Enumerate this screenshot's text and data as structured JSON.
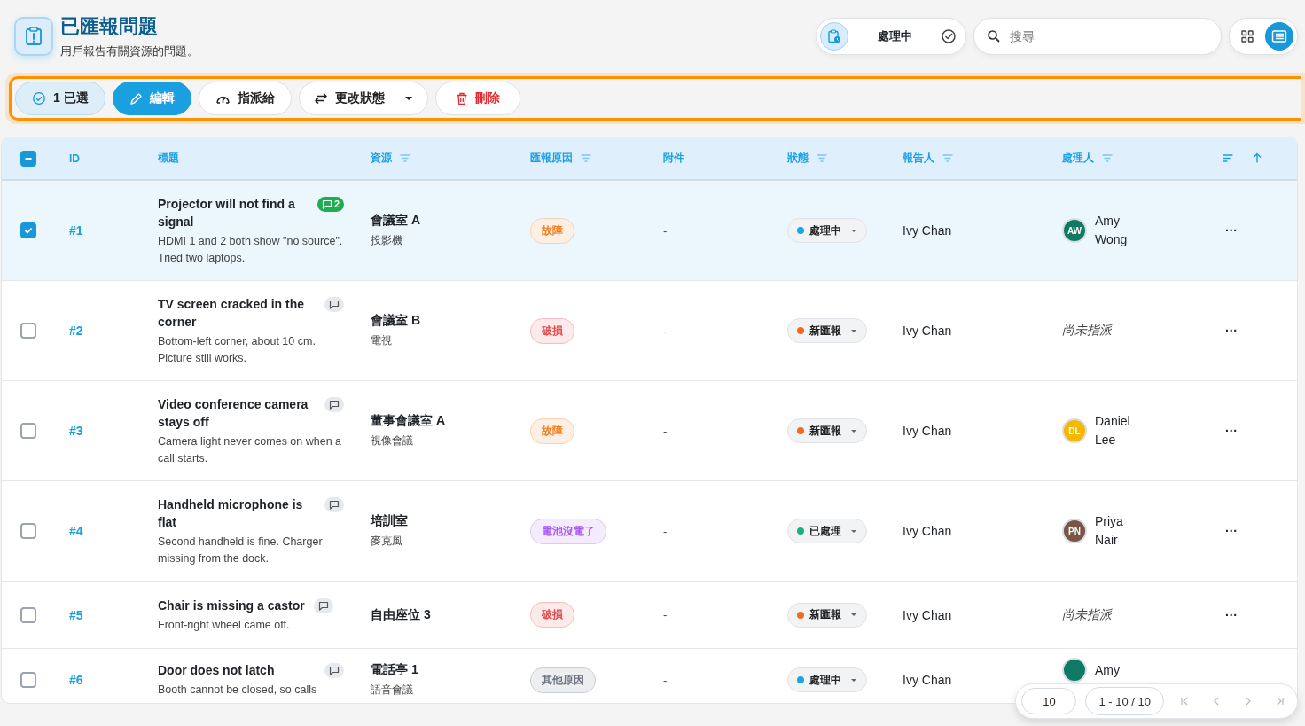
{
  "header": {
    "title": "已匯報問題",
    "subtitle": "用戶報告有關資源的問題。"
  },
  "status_filter": {
    "label": "處理中"
  },
  "search": {
    "placeholder": "搜尋"
  },
  "view_toggle": [
    {
      "kind": "grid",
      "selected": false
    },
    {
      "kind": "list",
      "selected": true
    }
  ],
  "toolbar": [
    {
      "kind": "count",
      "label": "1 已選"
    },
    {
      "kind": "primary",
      "label": "編輯"
    },
    {
      "kind": "assign",
      "label": "指派給"
    },
    {
      "kind": "status",
      "label": "更改狀態"
    },
    {
      "kind": "danger",
      "label": "刪除"
    }
  ],
  "table": {
    "select_all_partial": true,
    "columns": [
      {
        "label": "ID",
        "filter": false
      },
      {
        "label": "標題",
        "filter": false
      },
      {
        "label": "資源",
        "filter": true
      },
      {
        "label": "匯報原因",
        "filter": true
      },
      {
        "label": "附件",
        "filter": false
      },
      {
        "label": "狀態",
        "filter": true
      },
      {
        "label": "報告人",
        "filter": true
      },
      {
        "label": "處理人",
        "filter": true
      }
    ],
    "rows": [
      {
        "selected": true,
        "id": "#1",
        "title": "Projector will not find a signal",
        "comment_count": "2",
        "description": "HDMI 1 and 2 both show \"no source\". Tried two laptops.",
        "resource": "會議室 A",
        "resource_sub": "投影機",
        "reason": {
          "label": "故障",
          "color": "#f07d1a"
        },
        "attachments": "-",
        "status": {
          "label": "處理中",
          "color": "#1ba5e8"
        },
        "reporter": "Ivy Chan",
        "assignee": {
          "initials": "AW",
          "name": "Amy Wong",
          "color": "#0f7a63"
        },
        "menu": "···"
      },
      {
        "selected": false,
        "id": "#2",
        "title": "TV screen cracked in the corner",
        "description": "Bottom-left corner, about 10 cm. Picture still works.",
        "resource": "會議室 B",
        "resource_sub": "電視",
        "reason": {
          "label": "破損",
          "color": "#e5484d"
        },
        "attachments": "-",
        "status": {
          "label": "新匯報",
          "color": "#f26b1d"
        },
        "reporter": "Ivy Chan",
        "assignee": {
          "name": "尚未指派"
        },
        "menu": "···"
      },
      {
        "selected": false,
        "id": "#3",
        "title": "Video conference camera stays off",
        "description": "Camera light never comes on when a call starts.",
        "resource": "董事會議室 A",
        "resource_sub": "視像會議",
        "reason": {
          "label": "故障",
          "color": "#f07d1a"
        },
        "attachments": "-",
        "status": {
          "label": "新匯報",
          "color": "#f26b1d"
        },
        "reporter": "Ivy Chan",
        "assignee": {
          "initials": "DL",
          "name": "Daniel Lee",
          "color": "#f5b800"
        },
        "menu": "···"
      },
      {
        "selected": false,
        "id": "#4",
        "title": "Handheld microphone is flat",
        "description": "Second handheld is fine. Charger missing from the dock.",
        "resource": "培訓室",
        "resource_sub": "麥克風",
        "reason": {
          "label": "電池沒電了",
          "color": "#a855f7"
        },
        "attachments": "-",
        "status": {
          "label": "已處理",
          "color": "#16b47a"
        },
        "reporter": "Ivy Chan",
        "assignee": {
          "initials": "PN",
          "name": "Priya Nair",
          "color": "#7a5446"
        },
        "menu": "···"
      },
      {
        "selected": false,
        "id": "#5",
        "title": "Chair is missing a castor",
        "description": "Front-right wheel came off.",
        "resource": "自由座位 3",
        "reason": {
          "label": "破損",
          "color": "#e5484d"
        },
        "attachments": "-",
        "status": {
          "label": "新匯報",
          "color": "#f26b1d"
        },
        "reporter": "Ivy Chan",
        "assignee": {
          "name": "尚未指派"
        },
        "menu": "···"
      },
      {
        "selected": false,
        "id": "#6",
        "title": "Door does not latch",
        "description": "Booth cannot be closed, so calls",
        "resource": "電話亭 1",
        "resource_sub": "語音會議",
        "reason": {
          "label": "其他原因",
          "color": "#6b7280"
        },
        "attachments": "-",
        "status": {
          "label": "處理中",
          "color": "#1ba5e8"
        },
        "reporter": "Ivy Chan",
        "assignee": {
          "name": "Amy",
          "color": "#0f7a63"
        }
      }
    ]
  },
  "pagination": {
    "page_size": "10",
    "range": "1 - 10 / 10"
  }
}
